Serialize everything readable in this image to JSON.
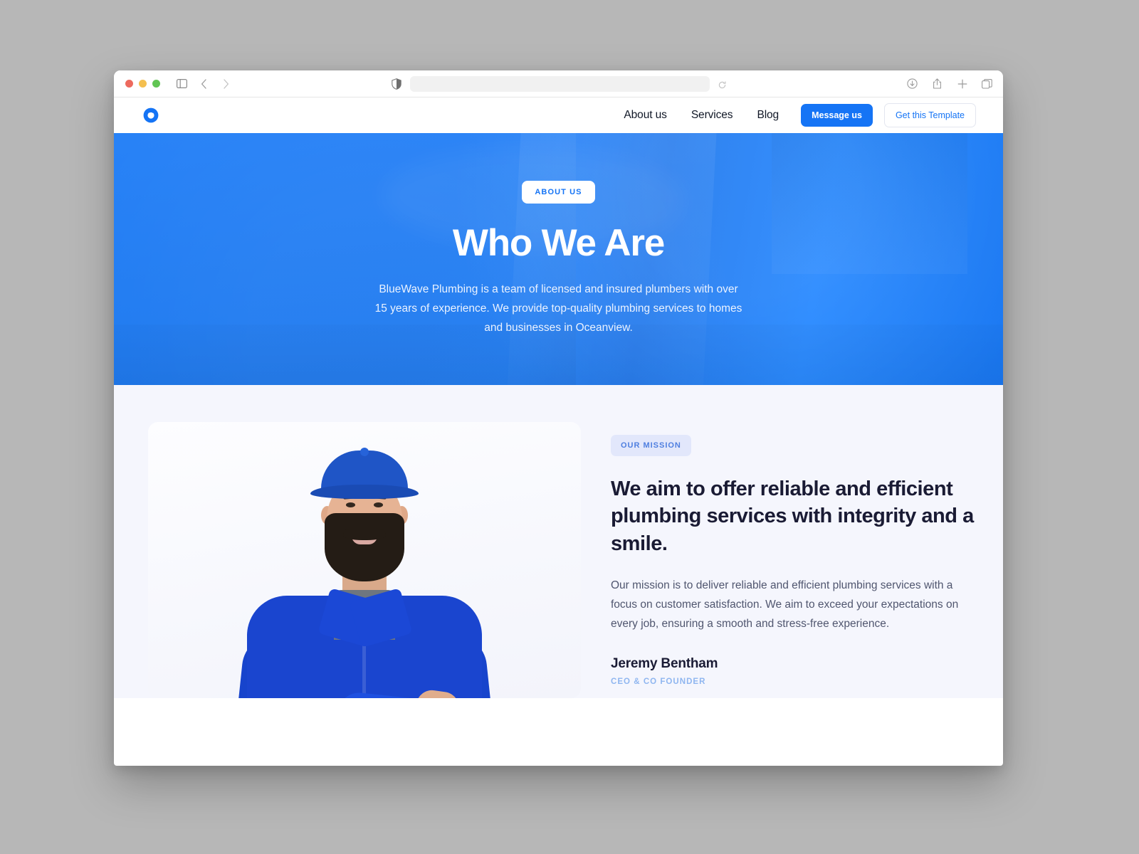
{
  "browser": {
    "traffic_lights": [
      "close",
      "minimize",
      "maximize"
    ],
    "toolbar_icons_left": [
      "sidebar-icon",
      "back-arrow-icon",
      "forward-arrow-icon"
    ],
    "address_bar": {
      "value": "",
      "placeholder": ""
    },
    "shield_icon": "privacy-shield-icon",
    "reload_icon": "reload-icon",
    "toolbar_icons_right": [
      "downloads-icon",
      "share-icon",
      "new-tab-icon",
      "tab-overview-icon"
    ]
  },
  "site_nav": {
    "logo_name": "bluewave-droplet-logo",
    "links": [
      {
        "label": "About us"
      },
      {
        "label": "Services"
      },
      {
        "label": "Blog"
      }
    ],
    "primary_button": "Message us",
    "ghost_button": "Get this Template"
  },
  "hero": {
    "badge": "ABOUT US",
    "title": "Who We Are",
    "subtitle": "BlueWave Plumbing is a team of licensed and insured plumbers with over 15 years of experience. We provide top-quality plumbing services to homes and businesses in Oceanview."
  },
  "mission": {
    "photo_alt": "plumber-portrait",
    "badge": "OUR MISSION",
    "title": "We aim to offer reliable and efficient plumbing services with integrity and a smile.",
    "body": "Our mission is to deliver reliable and efficient plumbing services with a focus on customer satisfaction. We aim to exceed your expectations on every job, ensuring a smooth and stress-free experience.",
    "person_name": "Jeremy Bentham",
    "person_role": "CEO & CO FOUNDER"
  },
  "colors": {
    "brand_blue": "#1574f5",
    "hero_blue": "#1a7af6",
    "section_bg": "#f5f6fd",
    "badge_muted_bg": "#e2e7fb",
    "heading_dark": "#1a1b34",
    "role_blue": "#8fb6f0"
  }
}
